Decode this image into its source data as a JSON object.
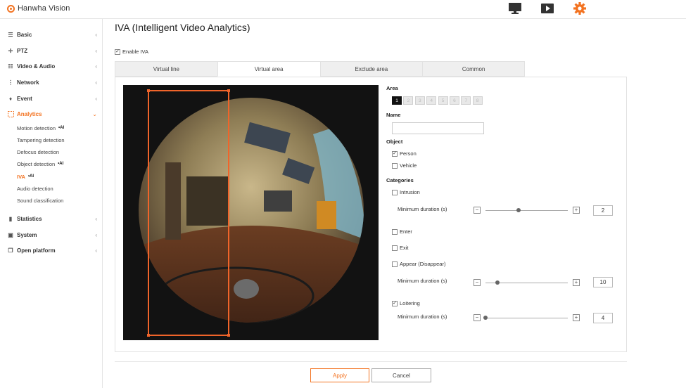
{
  "app": {
    "brand": "Hanwha Vision",
    "accent": "#f37321"
  },
  "topbar": {
    "icons": [
      "monitor-icon",
      "play-icon",
      "gear-icon"
    ]
  },
  "sidebar": {
    "items": [
      {
        "label": "Basic",
        "icon": "list-icon"
      },
      {
        "label": "PTZ",
        "icon": "move-icon"
      },
      {
        "label": "Video & Audio",
        "icon": "sliders-icon"
      },
      {
        "label": "Network",
        "icon": "network-icon"
      },
      {
        "label": "Event",
        "icon": "bell-icon"
      },
      {
        "label": "Analytics",
        "icon": "analytics-icon"
      },
      {
        "label": "Statistics",
        "icon": "bar-chart-icon"
      },
      {
        "label": "System",
        "icon": "system-icon"
      },
      {
        "label": "Open platform",
        "icon": "platform-icon"
      }
    ],
    "analytics_sub": [
      {
        "label": "Motion detection",
        "badge": "•AI"
      },
      {
        "label": "Tampering detection",
        "badge": ""
      },
      {
        "label": "Defocus detection",
        "badge": ""
      },
      {
        "label": "Object detection",
        "badge": "•AI"
      },
      {
        "label": "IVA",
        "badge": "•AI"
      },
      {
        "label": "Audio detection",
        "badge": ""
      },
      {
        "label": "Sound classification",
        "badge": ""
      }
    ]
  },
  "page": {
    "title": "IVA (Intelligent Video Analytics)",
    "enable_label": "Enable IVA",
    "enable_checked": true
  },
  "tabs": [
    "Virtual line",
    "Virtual area",
    "Exclude area",
    "Common"
  ],
  "active_tab": 1,
  "form": {
    "area_label": "Area",
    "area_numbers": [
      "1",
      "2",
      "3",
      "4",
      "5",
      "6",
      "7",
      "8"
    ],
    "active_area": 0,
    "name_label": "Name",
    "name_value": "",
    "object_label": "Object",
    "objects": [
      {
        "label": "Person",
        "checked": true
      },
      {
        "label": "Vehicle",
        "checked": false
      }
    ],
    "categories_label": "Categories",
    "categories": {
      "intrusion": {
        "label": "Intrusion",
        "checked": false
      },
      "enter": {
        "label": "Enter",
        "checked": false
      },
      "exit": {
        "label": "Exit",
        "checked": false
      },
      "appear": {
        "label": "Appear (Disappear)",
        "checked": false
      },
      "loitering": {
        "label": "Loitering",
        "checked": true
      }
    },
    "durations": [
      {
        "label": "Minimum duration (s)",
        "value": "2",
        "fraction": 0.4
      },
      {
        "label": "Minimum duration (s)",
        "value": "10",
        "fraction": 0.15
      },
      {
        "label": "Minimum duration (s)",
        "value": "4",
        "fraction": 0.0
      }
    ]
  },
  "buttons": {
    "apply": "Apply",
    "cancel": "Cancel"
  }
}
